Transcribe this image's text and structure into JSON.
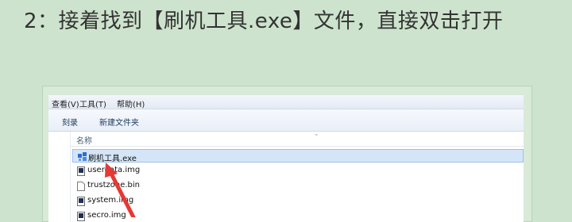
{
  "instruction": "2：接着找到【刷机工具.exe】文件，直接双击打开",
  "window": {
    "menu": [
      "查看(V)",
      "工具(T)",
      "帮助(H)"
    ],
    "toolbar": [
      "刻录",
      "新建文件夹"
    ],
    "column_header": "名称",
    "files": [
      {
        "name": "刷机工具.exe",
        "icon": "exe-app-icon",
        "selected": true
      },
      {
        "name": "userdata.img",
        "icon": "document-icon",
        "selected": false
      },
      {
        "name": "trustzone.bin",
        "icon": "blank-file-icon",
        "selected": false
      },
      {
        "name": "system.img",
        "icon": "document-icon",
        "selected": false
      },
      {
        "name": "secro.img",
        "icon": "document-icon",
        "selected": false
      }
    ]
  },
  "colors": {
    "background": "#cde3cd",
    "selection": "#d5e5f8",
    "annotation_arrow": "#e53935"
  }
}
